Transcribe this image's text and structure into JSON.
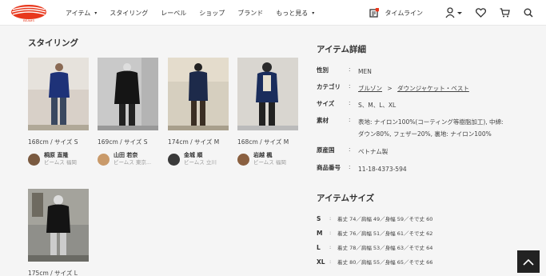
{
  "header": {
    "nav": [
      {
        "label": "アイテム",
        "has_caret": true
      },
      {
        "label": "スタイリング",
        "has_caret": false
      },
      {
        "label": "レーベル",
        "has_caret": false
      },
      {
        "label": "ショップ",
        "has_caret": false
      },
      {
        "label": "ブランド",
        "has_caret": false
      },
      {
        "label": "もっと見る",
        "has_caret": true
      }
    ],
    "caret": "▾",
    "timeline_label": "タイムライン",
    "icons": [
      "timeline-icon",
      "user-icon",
      "heart-icon",
      "cart-icon",
      "search-icon"
    ]
  },
  "styling": {
    "title": "スタイリング",
    "cards": [
      {
        "size": "168cm / サイズ S",
        "name": "桐原 直隆",
        "shop": "ビームス 福岡"
      },
      {
        "size": "169cm / サイズ S",
        "name": "山田 若奈",
        "shop": "ビームス 東京..."
      },
      {
        "size": "174cm / サイズ M",
        "name": "金城 順",
        "shop": "ビームス 立川"
      },
      {
        "size": "168cm / サイズ M",
        "name": "岩越 楓",
        "shop": "ビームス 福岡"
      },
      {
        "size": "175cm / サイズ L",
        "name": "",
        "shop": ""
      }
    ]
  },
  "item_detail": {
    "title": "アイテム詳細",
    "gender_label": "性別",
    "gender": "MEN",
    "category_label": "カテゴリ",
    "category_1": "ブルゾン",
    "category_sep": ">",
    "category_2": "ダウンジャケット・ベスト",
    "size_label": "サイズ",
    "sizes": "S、M、L、XL",
    "material_label": "素材",
    "material_line1": "表地: ナイロン100%(コーティング等樹脂加工), 中綿:",
    "material_line2": "ダウン80%, フェザー20%, 裏地: ナイロン100%",
    "origin_label": "原産国",
    "origin": "ベトナム製",
    "product_no_label": "商品番号",
    "product_no": "11-18-4373-594",
    "colon": ":"
  },
  "item_size": {
    "title": "アイテムサイズ",
    "rows": [
      {
        "size": "S",
        "value": "着丈 74／肩幅 49／身幅 59／そで丈 60"
      },
      {
        "size": "M",
        "value": "着丈 76／肩幅 51／身幅 61／そで丈 62"
      },
      {
        "size": "L",
        "value": "着丈 78／肩幅 53／身幅 63／そで丈 64"
      },
      {
        "size": "XL",
        "value": "着丈 80／肩幅 55／身幅 65／そで丈 66"
      }
    ]
  },
  "colors": {
    "brand": "#e8381d",
    "badge": "#e8381d",
    "background": "#f5f5f5"
  }
}
